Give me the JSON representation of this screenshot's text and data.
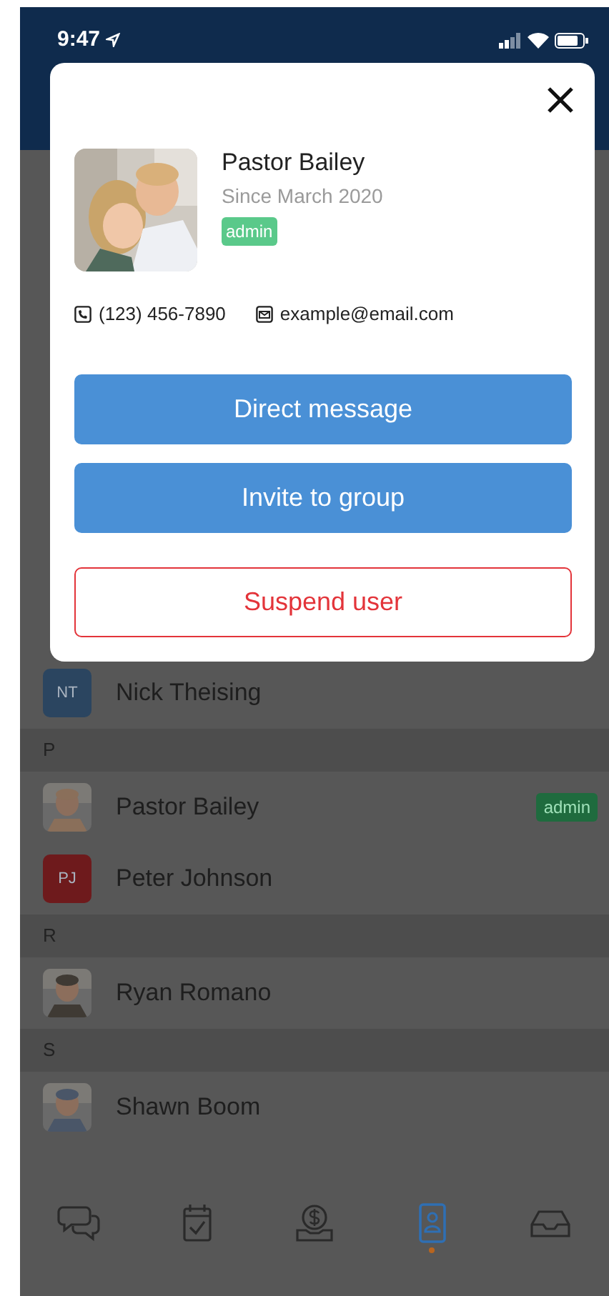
{
  "status_bar": {
    "time": "9:47"
  },
  "profile_card": {
    "name": "Pastor Bailey",
    "since": "Since March 2020",
    "badge": "admin",
    "phone": "(123) 456-7890",
    "email": "example@email.com",
    "buttons": [
      {
        "label": "Direct message",
        "kind": "primary"
      },
      {
        "label": "Invite to group",
        "kind": "primary"
      },
      {
        "label": "Suspend user",
        "kind": "danger"
      }
    ]
  },
  "contacts": [
    {
      "kind": "contact",
      "name": "Nick Theising",
      "initials": "NT",
      "color": "#2b4560"
    },
    {
      "kind": "section",
      "letter": "P"
    },
    {
      "kind": "contact",
      "name": "Pastor Bailey",
      "badge": "admin"
    },
    {
      "kind": "contact",
      "name": "Peter Johnson",
      "initials": "PJ",
      "color": "#6e1a1c"
    },
    {
      "kind": "section",
      "letter": "R"
    },
    {
      "kind": "contact",
      "name": "Ryan Romano"
    },
    {
      "kind": "section",
      "letter": "S"
    },
    {
      "kind": "contact",
      "name": "Shawn Boom"
    }
  ],
  "tab_bar": [
    {
      "kind": "chat",
      "selected": false
    },
    {
      "kind": "calendar",
      "selected": false
    },
    {
      "kind": "giving",
      "selected": false
    },
    {
      "kind": "contacts",
      "selected": true
    },
    {
      "kind": "inbox",
      "selected": false
    }
  ]
}
